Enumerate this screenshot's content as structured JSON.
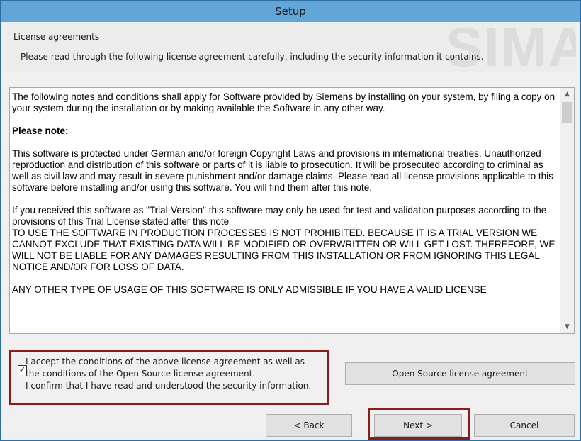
{
  "window": {
    "title": "Setup"
  },
  "header": {
    "title": "License agreements",
    "subtitle": "Please read through the following license agreement carefully, including the security information it contains.",
    "watermark": "SIMA"
  },
  "license": {
    "paragraphs": [
      "The following notes and conditions shall apply for Software provided by Siemens by installing on your system, by filing a copy on your system during the installation or by making available the Software in any other way.",
      "Please note:",
      "This software is protected under German and/or foreign Copyright Laws and provisions in international treaties. Unauthorized reproduction and distribution of this software or parts of it is liable to prosecution. It will be prosecuted according to criminal as well as civil law and may result in severe punishment and/or damage claims. Please read all license provisions applicable to this software before installing and/or using this software. You will find them after this note.",
      "If you received this software as \"Trial-Version\" this software may only be used for test and validation purposes according to the provisions of this Trial License stated after this note",
      "TO USE THE SOFTWARE IN PRODUCTION PROCESSES IS NOT PROHIBITED. BECAUSE IT IS A TRIAL VERSION WE CANNOT EXCLUDE THAT EXISTING DATA WILL BE MODIFIED OR OVERWRITTEN OR WILL GET LOST. THEREFORE, WE WILL NOT BE LIABLE FOR ANY DAMAGES RESULTING FROM THIS INSTALLATION OR FROM IGNORING THIS LEGAL NOTICE AND/OR FOR LOSS OF DATA.",
      "ANY OTHER TYPE OF USAGE OF THIS SOFTWARE IS ONLY ADMISSIBLE IF YOU HAVE A VALID LICENSE"
    ]
  },
  "accept": {
    "checked": true,
    "line1": "I accept the conditions of the above license agreement as well as",
    "line2": "the conditions of the Open Source license agreement.",
    "line3": "I confirm that I have read and understood the security information."
  },
  "buttons": {
    "open_source": "Open Source license agreement",
    "back": "< Back",
    "next": "Next >",
    "cancel": "Cancel"
  },
  "colors": {
    "titlebar": "#62a6d8",
    "highlight": "#8b1c1c"
  },
  "icons": {
    "checkbox": "check-mark",
    "scroll_up": "chevron-up-icon",
    "scroll_down": "chevron-down-icon"
  }
}
